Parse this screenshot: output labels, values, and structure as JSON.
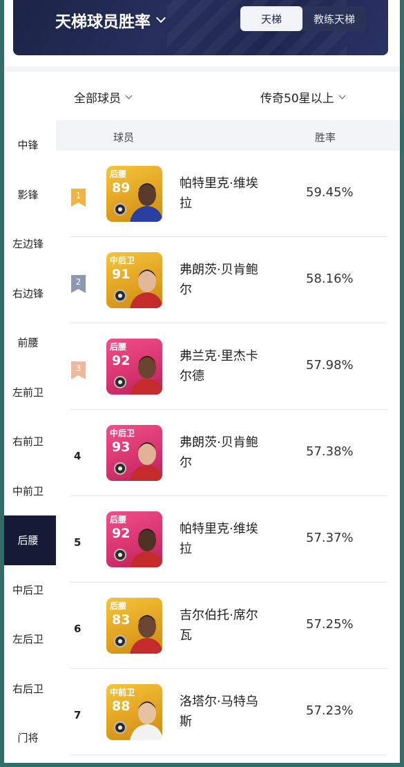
{
  "header": {
    "title": "天梯球员胜率",
    "tabs": [
      {
        "label": "天梯",
        "active": true
      },
      {
        "label": "教练天梯",
        "active": false
      }
    ]
  },
  "filters": {
    "players": "全部球员",
    "star_level": "传奇50星以上"
  },
  "sidebar": {
    "items": [
      {
        "label": "中锋",
        "active": false
      },
      {
        "label": "影锋",
        "active": false
      },
      {
        "label": "左边锋",
        "active": false
      },
      {
        "label": "右边锋",
        "active": false
      },
      {
        "label": "前腰",
        "active": false
      },
      {
        "label": "左前卫",
        "active": false
      },
      {
        "label": "右前卫",
        "active": false
      },
      {
        "label": "中前卫",
        "active": false
      },
      {
        "label": "后腰",
        "active": true
      },
      {
        "label": "中后卫",
        "active": false
      },
      {
        "label": "左后卫",
        "active": false
      },
      {
        "label": "右后卫",
        "active": false
      },
      {
        "label": "门将",
        "active": false
      }
    ]
  },
  "table": {
    "columns": {
      "player": "球员",
      "win_rate": "胜率"
    },
    "rows": [
      {
        "rank": "1",
        "flag": "gold",
        "position": "后腰",
        "rating": "89",
        "card": "gold",
        "name_line1": "帕特里克·维埃",
        "name_line2": "拉",
        "win_rate": "59.45%"
      },
      {
        "rank": "2",
        "flag": "silver",
        "position": "中后卫",
        "rating": "91",
        "card": "gold",
        "name_line1": "弗朗茨·贝肯鲍",
        "name_line2": "尔",
        "win_rate": "58.16%"
      },
      {
        "rank": "3",
        "flag": "bronze",
        "position": "后腰",
        "rating": "92",
        "card": "pink",
        "name_line1": "弗兰克·里杰卡",
        "name_line2": "尔德",
        "win_rate": "57.98%"
      },
      {
        "rank": "4",
        "flag": "",
        "position": "中后卫",
        "rating": "93",
        "card": "pink",
        "name_line1": "弗朗茨·贝肯鲍",
        "name_line2": "尔",
        "win_rate": "57.38%"
      },
      {
        "rank": "5",
        "flag": "",
        "position": "后腰",
        "rating": "92",
        "card": "pink",
        "name_line1": "帕特里克·维埃",
        "name_line2": "拉",
        "win_rate": "57.37%"
      },
      {
        "rank": "6",
        "flag": "",
        "position": "后腰",
        "rating": "83",
        "card": "gold",
        "name_line1": "吉尔伯托·席尔",
        "name_line2": "瓦",
        "win_rate": "57.25%"
      },
      {
        "rank": "7",
        "flag": "",
        "position": "中前卫",
        "rating": "88",
        "card": "gold",
        "name_line1": "洛塔尔·马特乌",
        "name_line2": "斯",
        "win_rate": "57.23%"
      }
    ]
  },
  "colors": {
    "banner": "#1c2346",
    "active_sidebar": "#151b36",
    "flag_gold": "#f2b43c",
    "flag_silver": "#8e98b0",
    "flag_bronze": "#f0b79a",
    "card_gold": "#e0a020",
    "card_pink": "#d6336e"
  }
}
